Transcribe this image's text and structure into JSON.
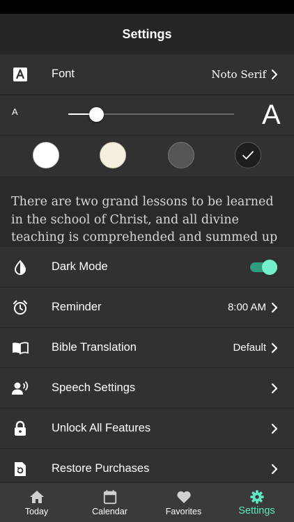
{
  "header": {
    "title": "Settings"
  },
  "font_row": {
    "label": "Font",
    "value": "Noto Serif",
    "icon": "font-icon"
  },
  "text_size": {
    "small_label": "A",
    "large_label": "A",
    "level": 0.17
  },
  "themes": [
    {
      "name": "white",
      "color": "#ffffff",
      "selected": false
    },
    {
      "name": "sepia",
      "color": "#f5efe0",
      "selected": false
    },
    {
      "name": "gray",
      "color": "#555557",
      "selected": false
    },
    {
      "name": "black",
      "color": "#1e1e1e",
      "selected": true
    }
  ],
  "preview_text": "There are two grand lessons to be learned in the school of Christ, and all divine teaching is comprehended and summed up",
  "settings": {
    "dark_mode": {
      "label": "Dark Mode",
      "enabled": true,
      "icon": "contrast-icon"
    },
    "reminder": {
      "label": "Reminder",
      "value": "8:00 AM",
      "icon": "alarm-clock-icon"
    },
    "bible_translation": {
      "label": "Bible Translation",
      "value": "Default",
      "icon": "open-book-icon"
    },
    "speech": {
      "label": "Speech Settings",
      "icon": "speaking-person-icon"
    },
    "unlock": {
      "label": "Unlock All Features",
      "icon": "lock-icon"
    },
    "restore": {
      "label": "Restore Purchases",
      "icon": "restore-file-icon"
    }
  },
  "tabs": [
    {
      "label": "Today",
      "icon": "house-icon",
      "active": false
    },
    {
      "label": "Calendar",
      "icon": "calendar-icon",
      "active": false
    },
    {
      "label": "Favorites",
      "icon": "heart-icon",
      "active": false
    },
    {
      "label": "Settings",
      "icon": "gear-icon",
      "active": true
    }
  ],
  "colors": {
    "accent": "#5ee8c3",
    "background": "#2c2c2c",
    "row": "#313131",
    "tab_bar": "#3a3a3a"
  }
}
